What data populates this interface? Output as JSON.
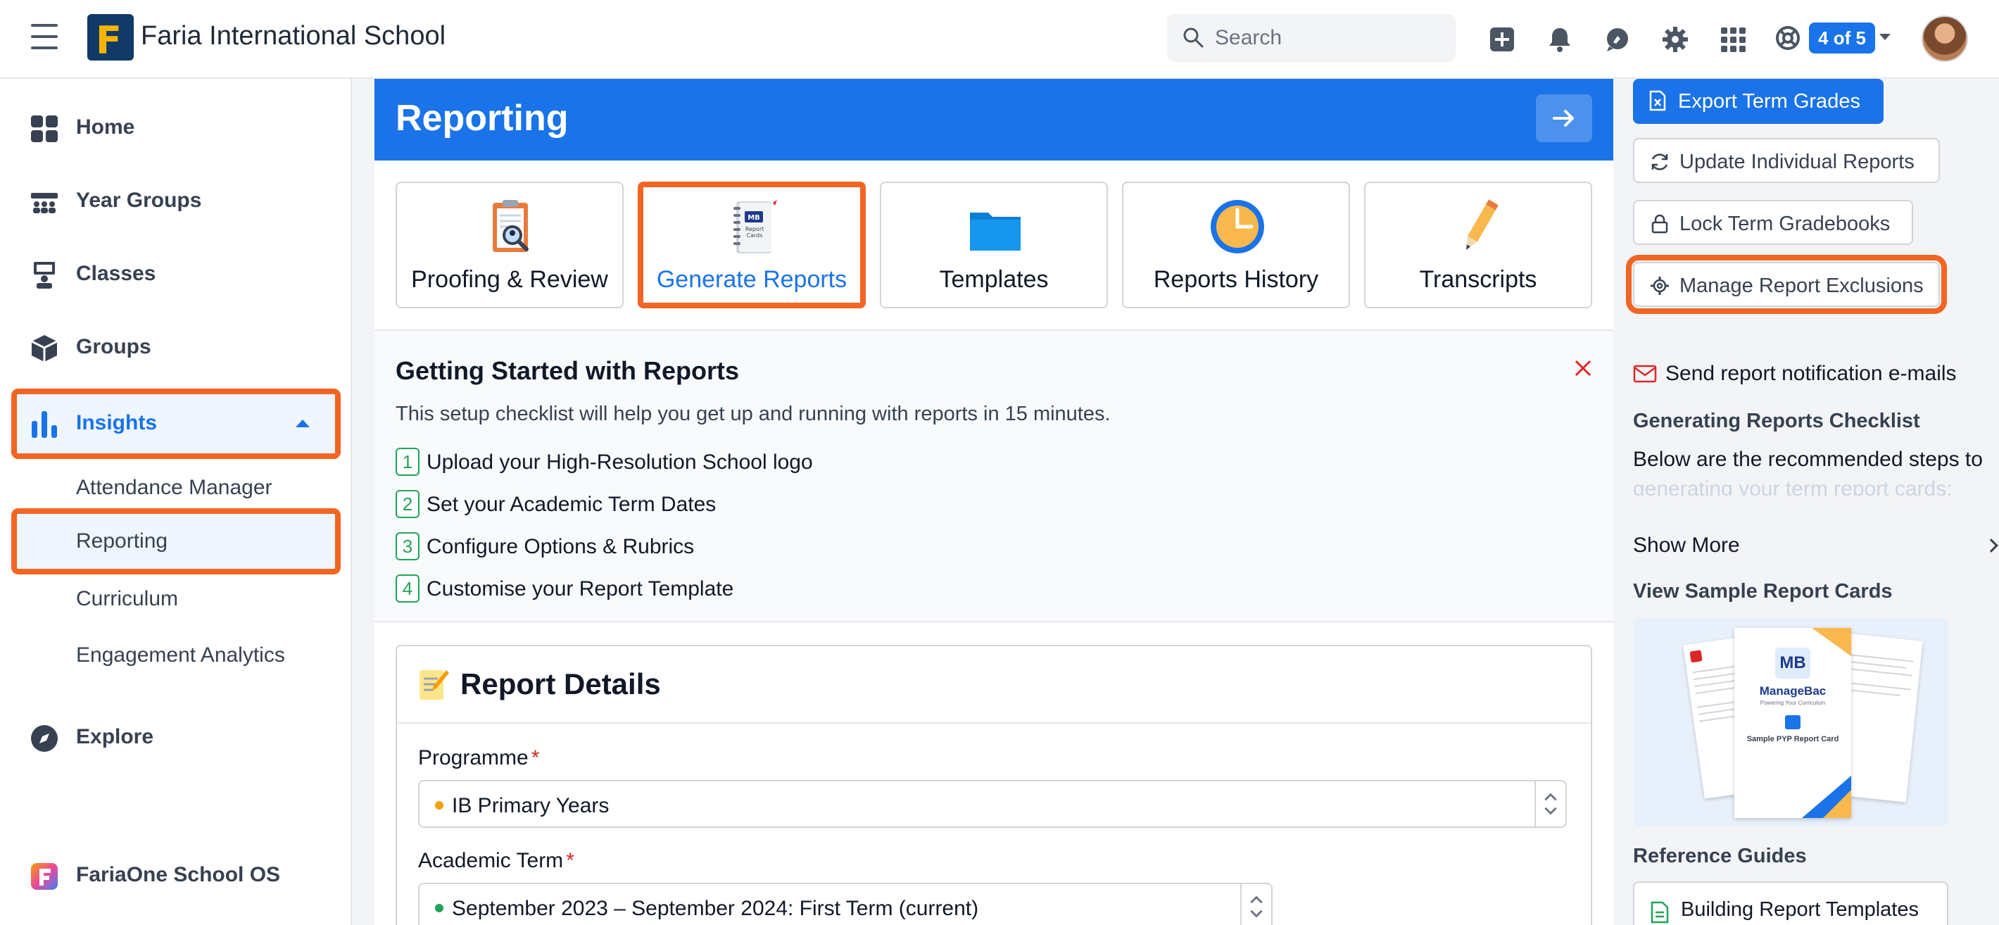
{
  "topbar": {
    "school_name": "Faria International School",
    "logo_letter": "F",
    "search_placeholder": "Search",
    "account_badge": "4 of 5",
    "icons": [
      "menu-icon",
      "plus-square-icon",
      "bell-icon",
      "chat-icon",
      "gear-icon",
      "apps-grid-icon",
      "lifebuoy-icon"
    ]
  },
  "sidebar": {
    "items": [
      {
        "label": "Home",
        "icon": "dashboard-icon"
      },
      {
        "label": "Year Groups",
        "icon": "people-icon"
      },
      {
        "label": "Classes",
        "icon": "teacher-icon"
      },
      {
        "label": "Groups",
        "icon": "cube-icon"
      },
      {
        "label": "Insights",
        "icon": "bar-chart-icon"
      },
      {
        "label": "Explore",
        "icon": "compass-icon"
      },
      {
        "label": "FariaOne School OS",
        "icon": "faria-one-icon"
      }
    ],
    "insights_sub": [
      {
        "label": "Attendance Manager"
      },
      {
        "label": "Reporting"
      },
      {
        "label": "Curriculum"
      },
      {
        "label": "Engagement Analytics"
      }
    ]
  },
  "main": {
    "banner_title": "Reporting",
    "cards": [
      {
        "label": "Proofing & Review",
        "icon": "clipboard-magnifier-icon"
      },
      {
        "label": "Generate Reports",
        "icon": "report-cards-notebook-icon",
        "badge": "Report Cards"
      },
      {
        "label": "Templates",
        "icon": "folder-icon"
      },
      {
        "label": "Reports History",
        "icon": "clock-icon"
      },
      {
        "label": "Transcripts",
        "icon": "pencil-icon"
      }
    ],
    "getting_started": {
      "title": "Getting Started with Reports",
      "description": "This setup checklist will help you get up and running with reports in 15 minutes.",
      "steps": [
        {
          "num": "1",
          "text": "Upload your High-Resolution School logo"
        },
        {
          "num": "2",
          "text": "Set your Academic Term Dates"
        },
        {
          "num": "3",
          "text": "Configure Options & Rubrics"
        },
        {
          "num": "4",
          "text": "Customise your Report Template"
        }
      ]
    },
    "details": {
      "title": "Report Details",
      "programme_label": "Programme",
      "programme_value": "IB Primary Years",
      "programme_dot_color": "#f59e0b",
      "term_label": "Academic Term",
      "term_value": "September 2023 – September 2024: First Term (current)",
      "term_dot_color": "#22a35a",
      "required_mark": "*"
    }
  },
  "right_panel": {
    "export_label": "Export Term Grades",
    "update_label": "Update Individual Reports",
    "lock_label": "Lock Term Gradebooks",
    "exclusions_label": "Manage Report Exclusions",
    "notify_label": "Send report notification e-mails",
    "checklist_heading": "Generating Reports Checklist",
    "checklist_text": "Below are the recommended steps to",
    "checklist_fade": "generating your term report cards:",
    "show_more": "Show More",
    "sample_heading": "View Sample Report Cards",
    "sample_brand": "ManageBac",
    "sample_tagline": "Powering Your Curriculum",
    "sample_caption": "Sample PYP Report Card",
    "sample_logo": "MB",
    "guides_heading": "Reference Guides",
    "guide_label": "Building Report Templates"
  },
  "colors": {
    "brand_blue": "#1a73e8",
    "highlight_orange": "#f26522",
    "step_green": "#22a35a"
  }
}
